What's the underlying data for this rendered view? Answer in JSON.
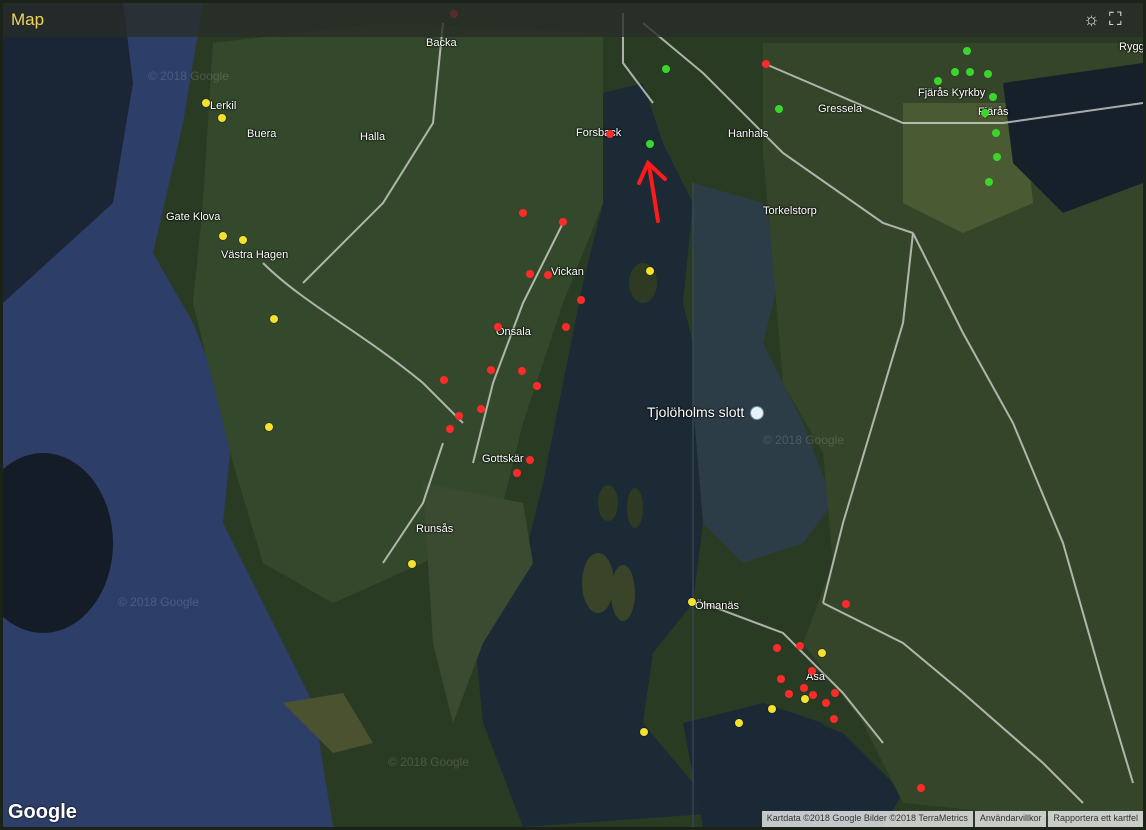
{
  "header": {
    "title": "Map"
  },
  "icons": {
    "brightness": "sun-icon",
    "fullscreen": "fullscreen-icon"
  },
  "places": [
    {
      "name": "Backa"
    },
    {
      "name": "Lerkil"
    },
    {
      "name": "Buera"
    },
    {
      "name": "Halla"
    },
    {
      "name": "Forsback"
    },
    {
      "name": "Hanhals"
    },
    {
      "name": "Gressela"
    },
    {
      "name": "Fjärås Kyrkby"
    },
    {
      "name": "Fjärås"
    },
    {
      "name": "Rygg"
    },
    {
      "name": "Gate Klova"
    },
    {
      "name": "Västra Hagen"
    },
    {
      "name": "Torkelstorp"
    },
    {
      "name": "Vickan"
    },
    {
      "name": "Onsala"
    },
    {
      "name": "Tjolöholms slott"
    },
    {
      "name": "Gottskär"
    },
    {
      "name": "Runsås"
    },
    {
      "name": "Ölmanäs"
    },
    {
      "name": "Åsa"
    }
  ],
  "watermarks": [
    "© 2018 Google",
    "© 2018 Google",
    "© 2018 Google",
    "© 2018 Google"
  ],
  "footer": {
    "logo": "Google",
    "attribution": [
      "Kartdata ©2018 Google Bilder ©2018 TerraMetrics",
      "Användarvillkor",
      "Rapportera ett kartfel"
    ]
  },
  "colors": {
    "title": "#f3d35a",
    "red_marker": "#ff2a2a",
    "yellow_marker": "#f5e22e",
    "green_marker": "#3ad62e",
    "arrow": "#ff1a1a"
  }
}
